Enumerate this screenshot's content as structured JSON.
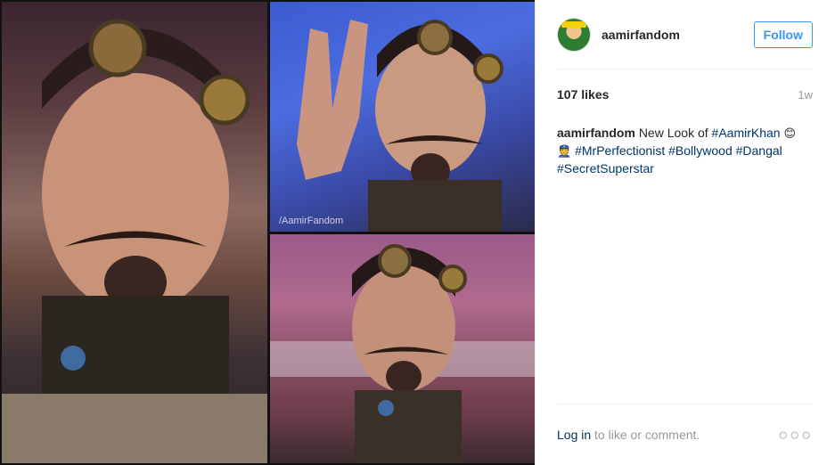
{
  "watermark": "/AamirFandom",
  "header": {
    "username": "aamirfandom",
    "follow_label": "Follow"
  },
  "stats": {
    "likes": "107 likes",
    "age": "1w"
  },
  "caption": {
    "username": "aamirfandom",
    "text_before": "New Look of",
    "tag1": "#AamirKhan",
    "emoji1": "😊",
    "emoji2": "👮",
    "tag2": "#MrPerfectionist",
    "tag3": "#Bollywood",
    "tag4": "#Dangal",
    "tag5": "#SecretSuperstar"
  },
  "footer": {
    "login_link": "Log in",
    "login_rest": " to like or comment.",
    "more": "○○○"
  },
  "colors": {
    "link": "#003569",
    "follow": "#3897f0",
    "muted": "#999999"
  }
}
